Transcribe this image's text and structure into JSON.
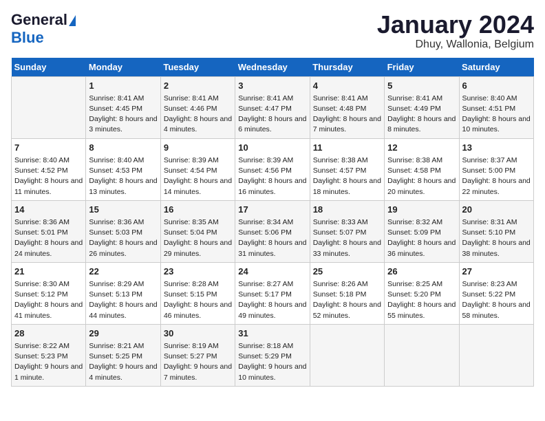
{
  "header": {
    "logo_general": "General",
    "logo_blue": "Blue",
    "title": "January 2024",
    "subtitle": "Dhuy, Wallonia, Belgium"
  },
  "days_of_week": [
    "Sunday",
    "Monday",
    "Tuesday",
    "Wednesday",
    "Thursday",
    "Friday",
    "Saturday"
  ],
  "weeks": [
    [
      {
        "num": "",
        "sunrise": "",
        "sunset": "",
        "daylight": ""
      },
      {
        "num": "1",
        "sunrise": "Sunrise: 8:41 AM",
        "sunset": "Sunset: 4:45 PM",
        "daylight": "Daylight: 8 hours and 3 minutes."
      },
      {
        "num": "2",
        "sunrise": "Sunrise: 8:41 AM",
        "sunset": "Sunset: 4:46 PM",
        "daylight": "Daylight: 8 hours and 4 minutes."
      },
      {
        "num": "3",
        "sunrise": "Sunrise: 8:41 AM",
        "sunset": "Sunset: 4:47 PM",
        "daylight": "Daylight: 8 hours and 6 minutes."
      },
      {
        "num": "4",
        "sunrise": "Sunrise: 8:41 AM",
        "sunset": "Sunset: 4:48 PM",
        "daylight": "Daylight: 8 hours and 7 minutes."
      },
      {
        "num": "5",
        "sunrise": "Sunrise: 8:41 AM",
        "sunset": "Sunset: 4:49 PM",
        "daylight": "Daylight: 8 hours and 8 minutes."
      },
      {
        "num": "6",
        "sunrise": "Sunrise: 8:40 AM",
        "sunset": "Sunset: 4:51 PM",
        "daylight": "Daylight: 8 hours and 10 minutes."
      }
    ],
    [
      {
        "num": "7",
        "sunrise": "Sunrise: 8:40 AM",
        "sunset": "Sunset: 4:52 PM",
        "daylight": "Daylight: 8 hours and 11 minutes."
      },
      {
        "num": "8",
        "sunrise": "Sunrise: 8:40 AM",
        "sunset": "Sunset: 4:53 PM",
        "daylight": "Daylight: 8 hours and 13 minutes."
      },
      {
        "num": "9",
        "sunrise": "Sunrise: 8:39 AM",
        "sunset": "Sunset: 4:54 PM",
        "daylight": "Daylight: 8 hours and 14 minutes."
      },
      {
        "num": "10",
        "sunrise": "Sunrise: 8:39 AM",
        "sunset": "Sunset: 4:56 PM",
        "daylight": "Daylight: 8 hours and 16 minutes."
      },
      {
        "num": "11",
        "sunrise": "Sunrise: 8:38 AM",
        "sunset": "Sunset: 4:57 PM",
        "daylight": "Daylight: 8 hours and 18 minutes."
      },
      {
        "num": "12",
        "sunrise": "Sunrise: 8:38 AM",
        "sunset": "Sunset: 4:58 PM",
        "daylight": "Daylight: 8 hours and 20 minutes."
      },
      {
        "num": "13",
        "sunrise": "Sunrise: 8:37 AM",
        "sunset": "Sunset: 5:00 PM",
        "daylight": "Daylight: 8 hours and 22 minutes."
      }
    ],
    [
      {
        "num": "14",
        "sunrise": "Sunrise: 8:36 AM",
        "sunset": "Sunset: 5:01 PM",
        "daylight": "Daylight: 8 hours and 24 minutes."
      },
      {
        "num": "15",
        "sunrise": "Sunrise: 8:36 AM",
        "sunset": "Sunset: 5:03 PM",
        "daylight": "Daylight: 8 hours and 26 minutes."
      },
      {
        "num": "16",
        "sunrise": "Sunrise: 8:35 AM",
        "sunset": "Sunset: 5:04 PM",
        "daylight": "Daylight: 8 hours and 29 minutes."
      },
      {
        "num": "17",
        "sunrise": "Sunrise: 8:34 AM",
        "sunset": "Sunset: 5:06 PM",
        "daylight": "Daylight: 8 hours and 31 minutes."
      },
      {
        "num": "18",
        "sunrise": "Sunrise: 8:33 AM",
        "sunset": "Sunset: 5:07 PM",
        "daylight": "Daylight: 8 hours and 33 minutes."
      },
      {
        "num": "19",
        "sunrise": "Sunrise: 8:32 AM",
        "sunset": "Sunset: 5:09 PM",
        "daylight": "Daylight: 8 hours and 36 minutes."
      },
      {
        "num": "20",
        "sunrise": "Sunrise: 8:31 AM",
        "sunset": "Sunset: 5:10 PM",
        "daylight": "Daylight: 8 hours and 38 minutes."
      }
    ],
    [
      {
        "num": "21",
        "sunrise": "Sunrise: 8:30 AM",
        "sunset": "Sunset: 5:12 PM",
        "daylight": "Daylight: 8 hours and 41 minutes."
      },
      {
        "num": "22",
        "sunrise": "Sunrise: 8:29 AM",
        "sunset": "Sunset: 5:13 PM",
        "daylight": "Daylight: 8 hours and 44 minutes."
      },
      {
        "num": "23",
        "sunrise": "Sunrise: 8:28 AM",
        "sunset": "Sunset: 5:15 PM",
        "daylight": "Daylight: 8 hours and 46 minutes."
      },
      {
        "num": "24",
        "sunrise": "Sunrise: 8:27 AM",
        "sunset": "Sunset: 5:17 PM",
        "daylight": "Daylight: 8 hours and 49 minutes."
      },
      {
        "num": "25",
        "sunrise": "Sunrise: 8:26 AM",
        "sunset": "Sunset: 5:18 PM",
        "daylight": "Daylight: 8 hours and 52 minutes."
      },
      {
        "num": "26",
        "sunrise": "Sunrise: 8:25 AM",
        "sunset": "Sunset: 5:20 PM",
        "daylight": "Daylight: 8 hours and 55 minutes."
      },
      {
        "num": "27",
        "sunrise": "Sunrise: 8:23 AM",
        "sunset": "Sunset: 5:22 PM",
        "daylight": "Daylight: 8 hours and 58 minutes."
      }
    ],
    [
      {
        "num": "28",
        "sunrise": "Sunrise: 8:22 AM",
        "sunset": "Sunset: 5:23 PM",
        "daylight": "Daylight: 9 hours and 1 minute."
      },
      {
        "num": "29",
        "sunrise": "Sunrise: 8:21 AM",
        "sunset": "Sunset: 5:25 PM",
        "daylight": "Daylight: 9 hours and 4 minutes."
      },
      {
        "num": "30",
        "sunrise": "Sunrise: 8:19 AM",
        "sunset": "Sunset: 5:27 PM",
        "daylight": "Daylight: 9 hours and 7 minutes."
      },
      {
        "num": "31",
        "sunrise": "Sunrise: 8:18 AM",
        "sunset": "Sunset: 5:29 PM",
        "daylight": "Daylight: 9 hours and 10 minutes."
      },
      {
        "num": "",
        "sunrise": "",
        "sunset": "",
        "daylight": ""
      },
      {
        "num": "",
        "sunrise": "",
        "sunset": "",
        "daylight": ""
      },
      {
        "num": "",
        "sunrise": "",
        "sunset": "",
        "daylight": ""
      }
    ]
  ]
}
